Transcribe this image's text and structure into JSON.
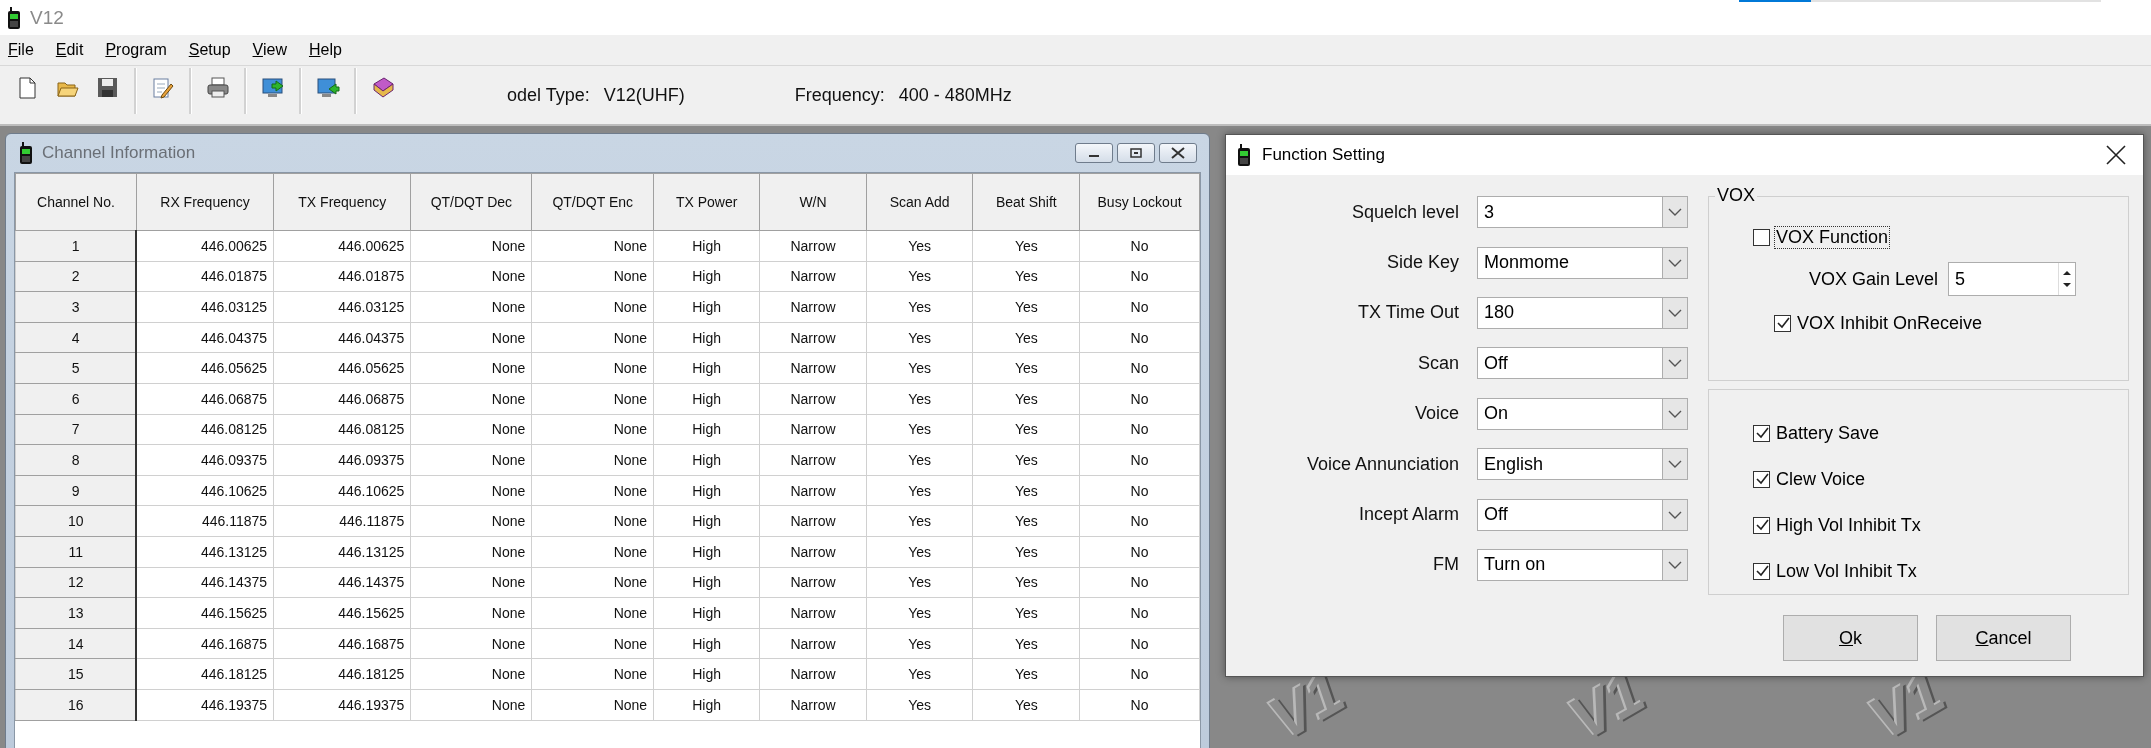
{
  "app": {
    "title": "V12"
  },
  "top_progress": {
    "level": 0.2
  },
  "menu": [
    "File",
    "Edit",
    "Program",
    "Setup",
    "View",
    "Help"
  ],
  "toolbar": [
    {
      "kind": "new"
    },
    {
      "kind": "open"
    },
    {
      "kind": "save"
    },
    {
      "kind": "separator"
    },
    {
      "kind": "edit"
    },
    {
      "kind": "separator"
    },
    {
      "kind": "print"
    },
    {
      "kind": "separator"
    },
    {
      "kind": "read"
    },
    {
      "kind": "separator"
    },
    {
      "kind": "write"
    },
    {
      "kind": "separator"
    },
    {
      "kind": "book"
    }
  ],
  "model_info": {
    "model_label": "odel Type:",
    "model_value": "V12(UHF)",
    "frequency_label": "Frequency:",
    "frequency_value": "400 - 480MHz"
  },
  "background_marks": [
    "V1",
    "V1",
    "V1"
  ],
  "channel_window": {
    "title": "Channel Information",
    "table": {
      "columns": [
        "Channel No.",
        "RX Frequency",
        "TX Frequency",
        "QT/DQT Dec",
        "QT/DQT Enc",
        "TX Power",
        "W/N",
        "Scan Add",
        "Beat Shift",
        "Busy Lockout"
      ],
      "rows": [
        [
          "1",
          "446.00625",
          "446.00625",
          "None",
          "None",
          "High",
          "Narrow",
          "Yes",
          "Yes",
          "No"
        ],
        [
          "2",
          "446.01875",
          "446.01875",
          "None",
          "None",
          "High",
          "Narrow",
          "Yes",
          "Yes",
          "No"
        ],
        [
          "3",
          "446.03125",
          "446.03125",
          "None",
          "None",
          "High",
          "Narrow",
          "Yes",
          "Yes",
          "No"
        ],
        [
          "4",
          "446.04375",
          "446.04375",
          "None",
          "None",
          "High",
          "Narrow",
          "Yes",
          "Yes",
          "No"
        ],
        [
          "5",
          "446.05625",
          "446.05625",
          "None",
          "None",
          "High",
          "Narrow",
          "Yes",
          "Yes",
          "No"
        ],
        [
          "6",
          "446.06875",
          "446.06875",
          "None",
          "None",
          "High",
          "Narrow",
          "Yes",
          "Yes",
          "No"
        ],
        [
          "7",
          "446.08125",
          "446.08125",
          "None",
          "None",
          "High",
          "Narrow",
          "Yes",
          "Yes",
          "No"
        ],
        [
          "8",
          "446.09375",
          "446.09375",
          "None",
          "None",
          "High",
          "Narrow",
          "Yes",
          "Yes",
          "No"
        ],
        [
          "9",
          "446.10625",
          "446.10625",
          "None",
          "None",
          "High",
          "Narrow",
          "Yes",
          "Yes",
          "No"
        ],
        [
          "10",
          "446.11875",
          "446.11875",
          "None",
          "None",
          "High",
          "Narrow",
          "Yes",
          "Yes",
          "No"
        ],
        [
          "11",
          "446.13125",
          "446.13125",
          "None",
          "None",
          "High",
          "Narrow",
          "Yes",
          "Yes",
          "No"
        ],
        [
          "12",
          "446.14375",
          "446.14375",
          "None",
          "None",
          "High",
          "Narrow",
          "Yes",
          "Yes",
          "No"
        ],
        [
          "13",
          "446.15625",
          "446.15625",
          "None",
          "None",
          "High",
          "Narrow",
          "Yes",
          "Yes",
          "No"
        ],
        [
          "14",
          "446.16875",
          "446.16875",
          "None",
          "None",
          "High",
          "Narrow",
          "Yes",
          "Yes",
          "No"
        ],
        [
          "15",
          "446.18125",
          "446.18125",
          "None",
          "None",
          "High",
          "Narrow",
          "Yes",
          "Yes",
          "No"
        ],
        [
          "16",
          "446.19375",
          "446.19375",
          "None",
          "None",
          "High",
          "Narrow",
          "Yes",
          "Yes",
          "No"
        ]
      ]
    }
  },
  "function_dialog": {
    "title": "Function Setting",
    "settings": [
      {
        "label": "Squelch level",
        "value": "3"
      },
      {
        "label": "Side Key",
        "value": "Monmome"
      },
      {
        "label": "TX Time Out",
        "value": "180"
      },
      {
        "label": "Scan",
        "value": "Off"
      },
      {
        "label": "Voice",
        "value": "On"
      },
      {
        "label": "Voice Annunciation",
        "value": "English"
      },
      {
        "label": "Incept Alarm",
        "value": "Off"
      },
      {
        "label": "FM",
        "value": "Turn on"
      }
    ],
    "vox": {
      "title": "VOX",
      "function": {
        "label": "VOX Function",
        "checked": false,
        "focused": true
      },
      "gain_label": "VOX Gain Level",
      "gain_value": "5",
      "inhibit": {
        "label": "VOX Inhibit OnReceive",
        "checked": true,
        "focused": false
      }
    },
    "options": [
      {
        "label": "Battery Save",
        "checked": true,
        "focused": false
      },
      {
        "label": "Clew Voice",
        "checked": true,
        "focused": false
      },
      {
        "label": "High Vol Inhibit Tx",
        "checked": true,
        "focused": false
      },
      {
        "label": "Low Vol Inhibit Tx",
        "checked": true,
        "focused": false
      }
    ],
    "buttons": [
      "Ok",
      "Cancel"
    ]
  }
}
